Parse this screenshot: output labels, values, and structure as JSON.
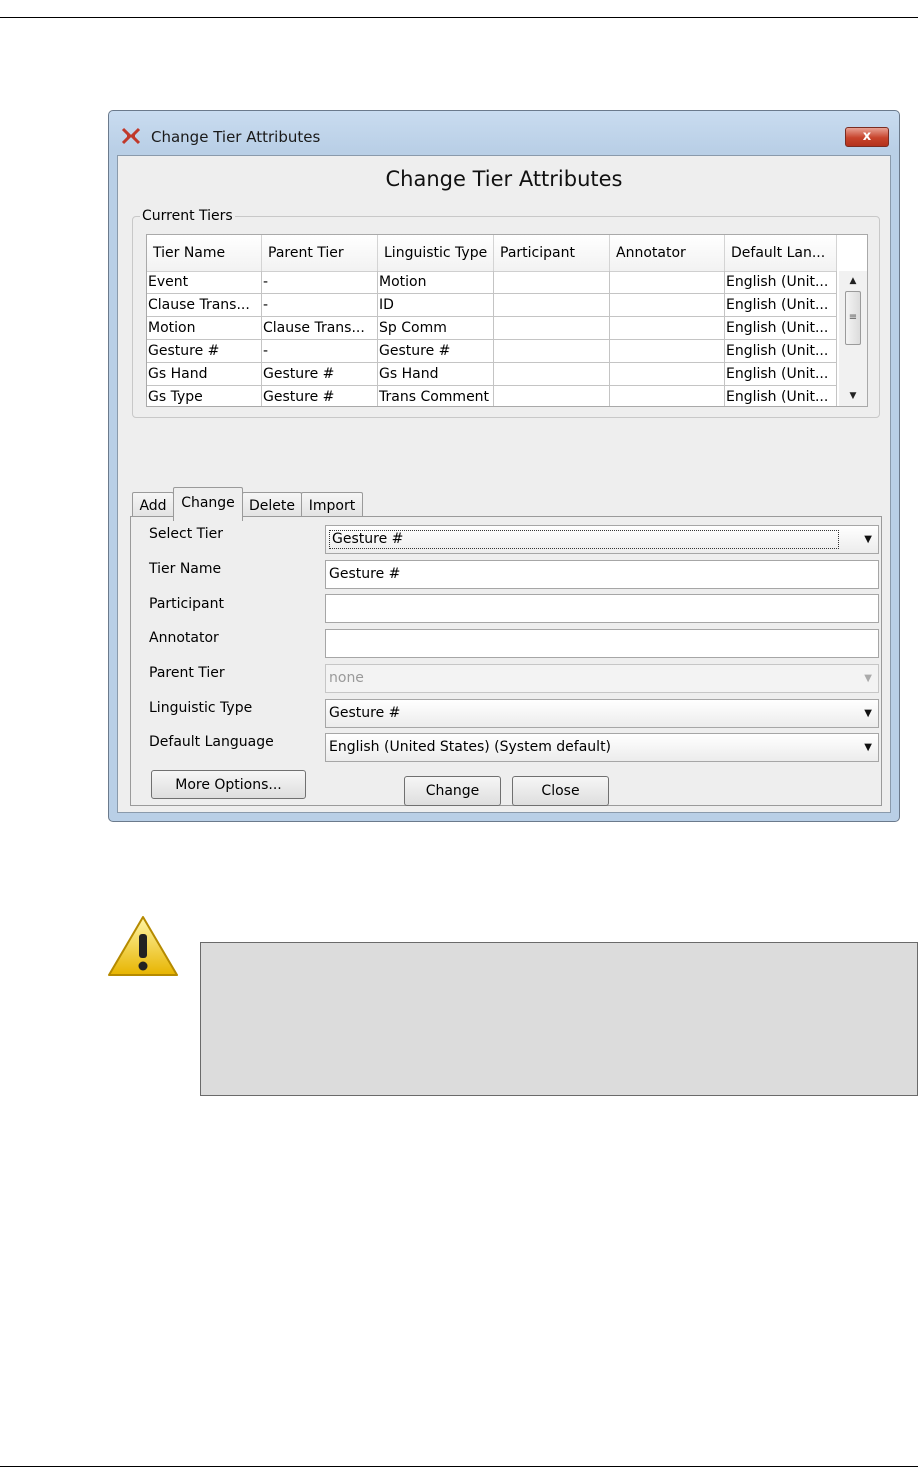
{
  "window": {
    "title": "Change Tier Attributes",
    "heading": "Change Tier Attributes",
    "close_label": "x"
  },
  "current_tiers": {
    "legend": "Current Tiers",
    "columns": [
      "Tier Name",
      "Parent Tier",
      "Linguistic Type",
      "Participant",
      "Annotator",
      "Default Lan..."
    ],
    "rows": [
      [
        "Event",
        "-",
        "Motion",
        "",
        "",
        "English (Unit..."
      ],
      [
        "Clause Trans...",
        "-",
        "ID",
        "",
        "",
        "English (Unit..."
      ],
      [
        "Motion",
        "Clause Trans...",
        "Sp Comm",
        "",
        "",
        "English (Unit..."
      ],
      [
        "Gesture #",
        "-",
        "Gesture #",
        "",
        "",
        "English (Unit..."
      ],
      [
        "Gs Hand",
        "Gesture #",
        "Gs Hand",
        "",
        "",
        "English (Unit..."
      ],
      [
        "Gs Type",
        "Gesture #",
        "Trans Comment",
        "",
        "",
        "English (Unit..."
      ]
    ]
  },
  "tabs": [
    "Add",
    "Change",
    "Delete",
    "Import"
  ],
  "form": {
    "select_tier_label": "Select Tier",
    "select_tier_value": "Gesture #",
    "tier_name_label": "Tier Name",
    "tier_name_value": "Gesture #",
    "participant_label": "Participant",
    "participant_value": "",
    "annotator_label": "Annotator",
    "annotator_value": "",
    "parent_tier_label": "Parent Tier",
    "parent_tier_value": "none",
    "linguistic_type_label": "Linguistic Type",
    "linguistic_type_value": "Gesture #",
    "default_language_label": "Default Language",
    "default_language_value": "English (United States) (System default)",
    "more_options_label": "More Options..."
  },
  "buttons": {
    "change_label": "Change",
    "close_label": "Close"
  }
}
